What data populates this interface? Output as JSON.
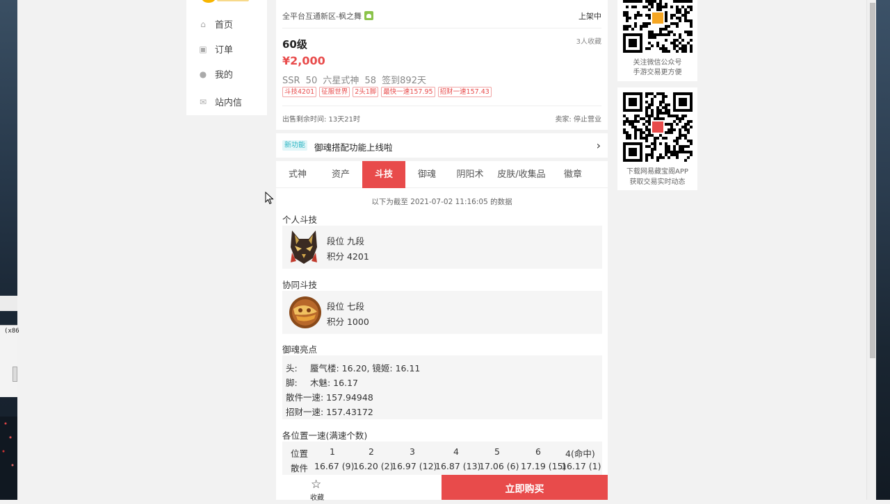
{
  "nav": {
    "items": [
      {
        "label": "首页",
        "icon": "home-icon"
      },
      {
        "label": "订单",
        "icon": "order-icon"
      },
      {
        "label": "我的",
        "icon": "user-icon"
      },
      {
        "label": "站内信",
        "icon": "mail-icon"
      }
    ]
  },
  "listing": {
    "server": "全平台互通新区-枫之舞",
    "status": "上架中",
    "level": "60级",
    "favorites": "3人收藏",
    "price": "¥2,000",
    "stats": "SSR 50   六星式神 58   签到892天",
    "tags": [
      "斗技4201",
      "征服世界",
      "2头1脚",
      "最快一速157.95",
      "招财一速157.43"
    ],
    "remaining": "出售剩余时间: 13天21时",
    "seller": "卖家: 停止营业"
  },
  "notice": {
    "badge": "新功能",
    "text": "御魂搭配功能上线啦"
  },
  "tabs": [
    "式神",
    "资产",
    "斗技",
    "御魂",
    "阴阳术",
    "皮肤/收集品",
    "徽章"
  ],
  "active_tab": "斗技",
  "pvp": {
    "as_of": "以下为截至 2021-07-02 11:16:05 的数据",
    "personal_title": "个人斗技",
    "personal_rank": "段位  九段",
    "personal_score": "积分  4201",
    "coop_title": "协同斗技",
    "coop_rank": "段位  七段",
    "coop_score": "积分  1000",
    "yuhun_title": "御魂亮点",
    "yuhun": [
      {
        "k": "头:",
        "v": "蜃气楼: 16.20, 镜姬: 16.11"
      },
      {
        "k": "脚:",
        "v": "木魅: 16.17"
      },
      {
        "k": "",
        "v": "散件一速: 157.94948"
      },
      {
        "k": "",
        "v": "招财一速: 157.43172"
      }
    ],
    "speed_title": "各位置一速(满速个数)",
    "speed_header": [
      "位置",
      "1",
      "2",
      "3",
      "4",
      "5",
      "6",
      "4(命中)"
    ],
    "speed_row": [
      "散件",
      "16.67 (9)",
      "16.20 (2)",
      "16.97 (12)",
      "16.87 (13)",
      "17.06 (6)",
      "17.19 (15)",
      "16.17 (1)"
    ]
  },
  "bottom": {
    "fav_label": "收藏",
    "buy_label": "立即购买"
  },
  "qr": [
    {
      "line1": "关注微信公众号",
      "line2": "手游交易更方便"
    },
    {
      "line1": "下载网易藏宝阁APP",
      "line2": "获取交易实时动态"
    }
  ],
  "desktop": {
    "snippet": "(x86"
  },
  "colors": {
    "accent": "#e84b4b",
    "badge": "#2bb5c3"
  }
}
